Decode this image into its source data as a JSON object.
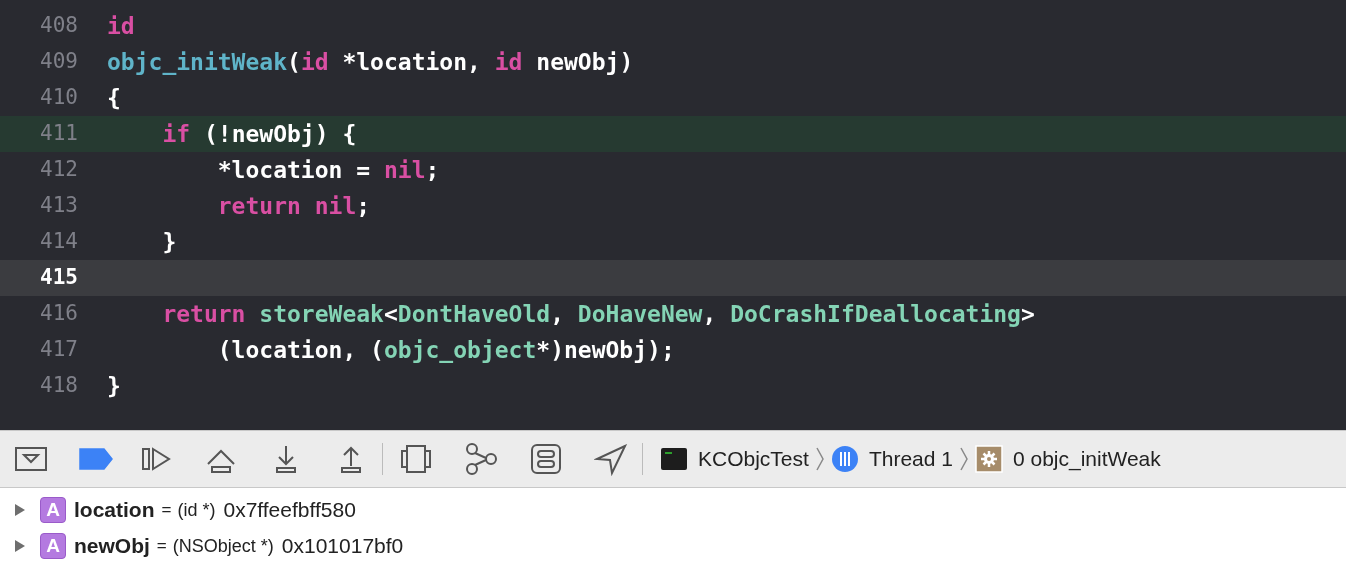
{
  "code_lines": [
    {
      "number": "408",
      "current": false,
      "marked": false,
      "tokens": [
        {
          "kind": "keyword",
          "text": "id"
        }
      ]
    },
    {
      "number": "409",
      "current": false,
      "marked": false,
      "tokens": [
        {
          "kind": "function",
          "text": "objc_initWeak"
        },
        {
          "kind": "plain",
          "text": "("
        },
        {
          "kind": "keyword",
          "text": "id"
        },
        {
          "kind": "plain",
          "text": " *location, "
        },
        {
          "kind": "keyword",
          "text": "id"
        },
        {
          "kind": "plain",
          "text": " newObj)"
        }
      ]
    },
    {
      "number": "410",
      "current": false,
      "marked": false,
      "tokens": [
        {
          "kind": "plain",
          "text": "{"
        }
      ]
    },
    {
      "number": "411",
      "current": false,
      "marked": true,
      "tokens": [
        {
          "kind": "keyword",
          "text": "    if"
        },
        {
          "kind": "plain",
          "text": " (!newObj) {"
        }
      ]
    },
    {
      "number": "412",
      "current": false,
      "marked": false,
      "tokens": [
        {
          "kind": "plain",
          "text": "        *location = "
        },
        {
          "kind": "keyword",
          "text": "nil"
        },
        {
          "kind": "plain",
          "text": ";"
        }
      ]
    },
    {
      "number": "413",
      "current": false,
      "marked": false,
      "tokens": [
        {
          "kind": "keyword",
          "text": "        return nil"
        },
        {
          "kind": "plain",
          "text": ";"
        }
      ]
    },
    {
      "number": "414",
      "current": false,
      "marked": false,
      "tokens": [
        {
          "kind": "plain",
          "text": "    }"
        }
      ]
    },
    {
      "number": "415",
      "current": true,
      "marked": false
    },
    {
      "number": "416",
      "current": false,
      "marked": false,
      "tokens": [
        {
          "kind": "keyword",
          "text": "    return "
        },
        {
          "kind": "type",
          "text": "storeWeak"
        },
        {
          "kind": "plain",
          "text": "<"
        },
        {
          "kind": "type",
          "text": "DontHaveOld"
        },
        {
          "kind": "plain",
          "text": ", "
        },
        {
          "kind": "type",
          "text": "DoHaveNew"
        },
        {
          "kind": "plain",
          "text": ", "
        },
        {
          "kind": "type",
          "text": "DoCrashIfDeallocating"
        },
        {
          "kind": "plain",
          "text": ">"
        }
      ]
    },
    {
      "number": "417",
      "current": false,
      "marked": false,
      "tokens": [
        {
          "kind": "plain",
          "text": "        (location, ("
        },
        {
          "kind": "type",
          "text": "objc_object"
        },
        {
          "kind": "plain",
          "text": "*)newObj);"
        }
      ]
    },
    {
      "number": "418",
      "current": false,
      "marked": false,
      "tokens": [
        {
          "kind": "plain",
          "text": "}"
        }
      ]
    }
  ],
  "debug_bar": {
    "breakpoints_active": true,
    "path": [
      {
        "kind": "process",
        "label": "KCObjcTest"
      },
      {
        "kind": "thread",
        "label": "Thread 1"
      },
      {
        "kind": "frame",
        "label": "0 objc_initWeak"
      }
    ]
  },
  "variables": [
    {
      "badge": "A",
      "name": "location",
      "equals": "=",
      "type": "(id *)",
      "value": "0x7ffeefbff580"
    },
    {
      "badge": "A",
      "name": "newObj",
      "equals": "=",
      "type": "(NSObject *)",
      "value": "0x101017bf0"
    }
  ]
}
